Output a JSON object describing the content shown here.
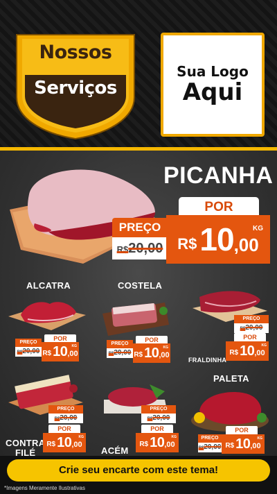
{
  "header": {
    "badge_line1": "Nossos",
    "badge_line2": "Serviços",
    "logo_line1": "Sua Logo",
    "logo_line2": "Aqui"
  },
  "featured": {
    "name": "PICANHA",
    "por_label": "POR",
    "preco_label": "PREÇO",
    "old_price_currency": "R$",
    "old_price": "20,00",
    "currency": "R$",
    "price_int": "10",
    "price_dec": ",00",
    "unit": "KG"
  },
  "products": [
    {
      "name": "ALCATRA",
      "preco_label": "PREÇO",
      "por_label": "POR",
      "old_price": "20,00",
      "old_currency": "R$",
      "currency": "R$",
      "price_int": "10",
      "price_dec": ",00",
      "unit": "KG"
    },
    {
      "name": "COSTELA",
      "preco_label": "PREÇO",
      "por_label": "POR",
      "old_price": "20,00",
      "old_currency": "R$",
      "currency": "R$",
      "price_int": "10",
      "price_dec": ",00",
      "unit": "KG"
    },
    {
      "name": "FRALDINHA",
      "preco_label": "PREÇO",
      "por_label": "POR",
      "old_price": "20,00",
      "old_currency": "R$",
      "currency": "R$",
      "price_int": "10",
      "price_dec": ",00",
      "unit": "KG"
    },
    {
      "name_line1": "CONTRA",
      "name_line2": "FILÉ",
      "preco_label": "PREÇO",
      "por_label": "POR",
      "old_price": "20,00",
      "old_currency": "R$",
      "currency": "R$",
      "price_int": "10",
      "price_dec": ",00",
      "unit": "KG"
    },
    {
      "name": "ACÉM",
      "preco_label": "PREÇO",
      "por_label": "POR",
      "old_price": "20,00",
      "old_currency": "R$",
      "currency": "R$",
      "price_int": "10",
      "price_dec": ",00",
      "unit": "KG"
    },
    {
      "name": "PALETA",
      "preco_label": "PREÇO",
      "por_label": "POR",
      "old_price": "20,00",
      "old_currency": "R$",
      "currency": "R$",
      "price_int": "10",
      "price_dec": ",00",
      "unit": "KG"
    }
  ],
  "footer": {
    "cta": "Crie seu encarte com este tema!",
    "note": "*Imagens Meramente Ilustrativas"
  },
  "colors": {
    "accent_orange": "#e4560f",
    "yellow": "#f6c400",
    "shield_gold": "#f0a800",
    "dark": "#1a1a1a"
  }
}
